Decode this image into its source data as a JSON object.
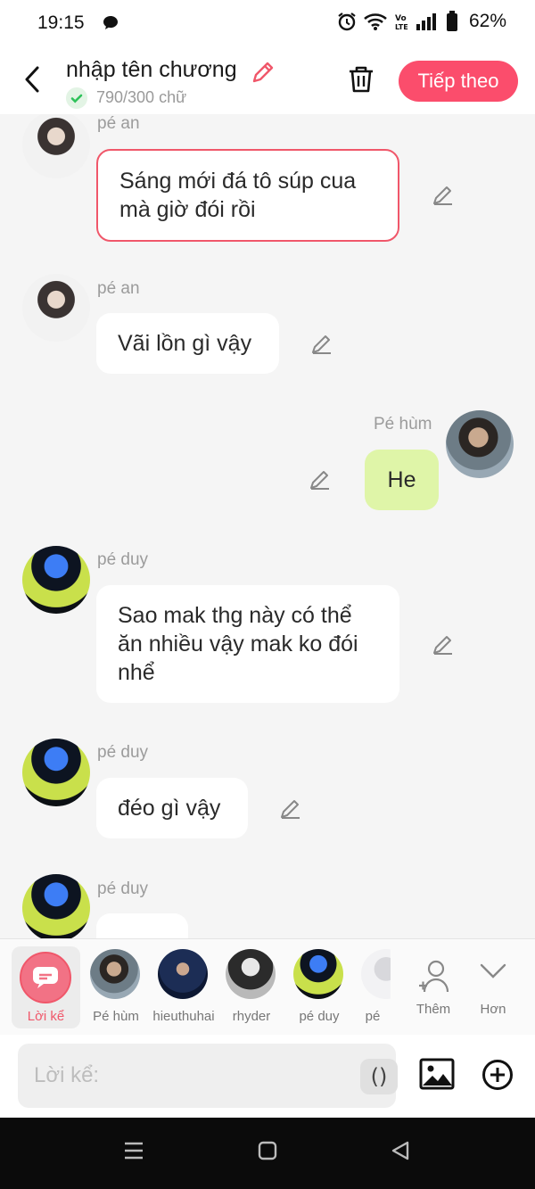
{
  "status_bar": {
    "time": "19:15",
    "battery": "62%",
    "icons": [
      "chat-bubble-icon",
      "alarm-icon",
      "wifi-icon",
      "volte-icon",
      "signal-icon",
      "battery-icon"
    ]
  },
  "header": {
    "title": "nhập tên chương",
    "word_count": "790/300 chữ",
    "next_label": "Tiếp theo"
  },
  "messages": [
    {
      "side": "left",
      "sender": "pé an",
      "text": "Sáng mới đá tô súp cua mà giờ đói rồi",
      "selected": true
    },
    {
      "side": "left",
      "sender": "pé an",
      "text": "Vãi lồn gì vậy"
    },
    {
      "side": "right",
      "sender": "Pé hùm",
      "text": "He"
    },
    {
      "side": "left",
      "sender": "pé duy",
      "text": "Sao mak thg này có thể ăn nhiều vậy mak ko đói nhể"
    },
    {
      "side": "left",
      "sender": "pé duy",
      "text": "đéo gì vậy"
    },
    {
      "side": "left",
      "sender": "pé duy",
      "text": ""
    }
  ],
  "characters": {
    "narrator_label": "Lời kể",
    "items": [
      "Pé hùm",
      "hieuthuhai",
      "rhyder",
      "pé duy",
      "pé"
    ],
    "add_label": "Thêm",
    "more_label": "Hơn"
  },
  "input": {
    "placeholder": "Lời kể:",
    "paren_label": "()"
  },
  "colors": {
    "accent": "#fb4d6c",
    "my_bubble": "#dff5a8",
    "selected_border": "#f0576a"
  }
}
